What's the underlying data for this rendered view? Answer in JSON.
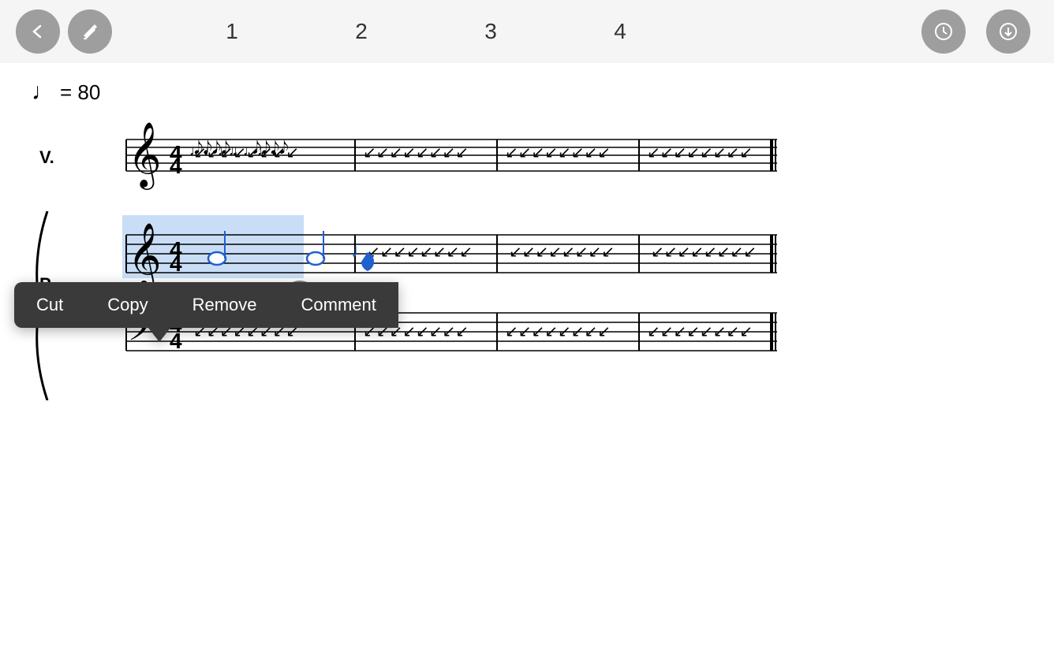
{
  "topbar": {
    "back_icon": "←",
    "edit_icon": "✎",
    "history_icon": "🕐",
    "download_icon": "⬇"
  },
  "beat_numbers": [
    "1",
    "2",
    "3",
    "4"
  ],
  "tempo": {
    "note": "♩",
    "value": "= 80"
  },
  "context_menu": {
    "cut_label": "Cut",
    "copy_label": "Copy",
    "remove_label": "Remove",
    "comment_label": "Comment"
  },
  "instruments": [
    {
      "label": "V."
    },
    {
      "label": "P."
    }
  ],
  "colors": {
    "accent": "#9e9e9e",
    "blue": "#2979ff",
    "dark": "#3a3a3a"
  }
}
